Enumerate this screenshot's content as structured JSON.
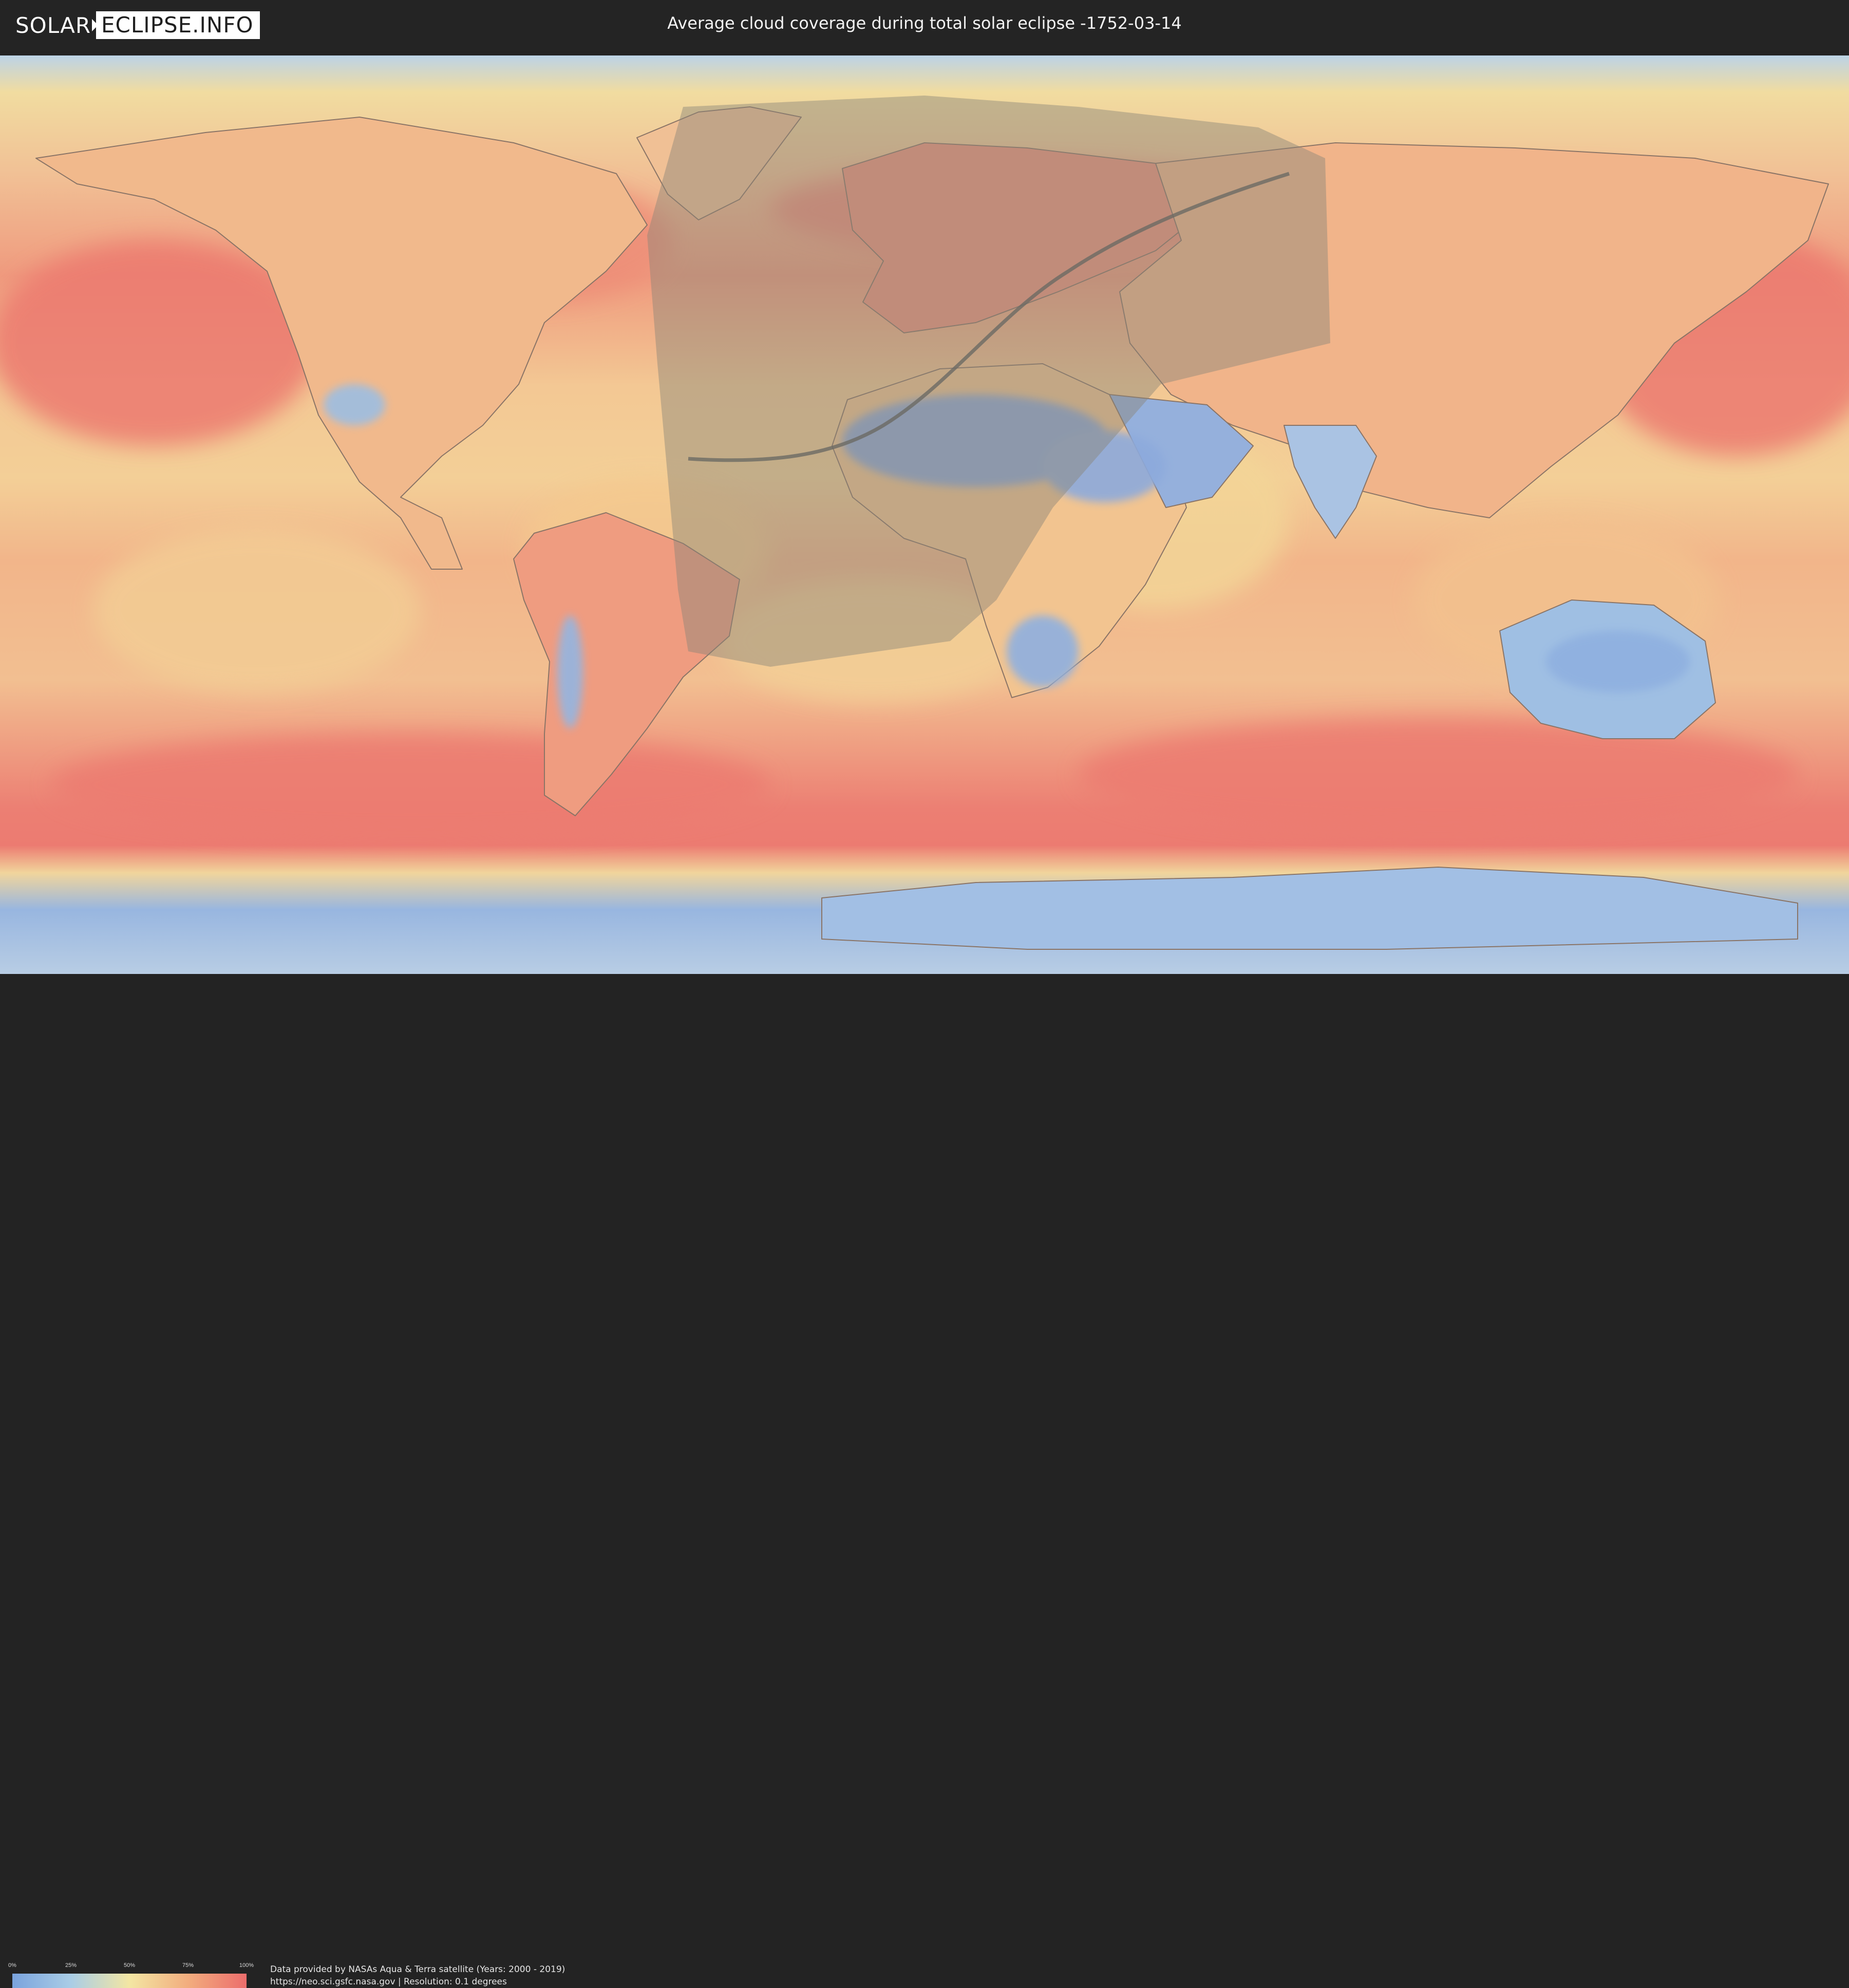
{
  "header": {
    "logo_part1": "SOLAR",
    "logo_part2": "ECLIPSE.INFO",
    "title": "Average cloud coverage during total solar eclipse -1752-03-14"
  },
  "legend": {
    "ticks": [
      "0%",
      "25%",
      "50%",
      "75%",
      "100%"
    ],
    "colors": [
      "#7aa3dd",
      "#a9cde6",
      "#f3e6a3",
      "#f2ad7e",
      "#ec6d6c"
    ]
  },
  "footer": {
    "credit_line1": "Data provided by NASAs Aqua & Terra satellite (Years: 2000 - 2019)",
    "credit_line2": "https://neo.sci.gsfc.nasa.gov | Resolution: 0.1 degrees"
  },
  "map": {
    "ocean_color": "#f1a583",
    "land_outline_color": "#8a7466",
    "eclipse_zone_color": "#8a8578",
    "eclipse_path_color": "#6b6a64"
  }
}
